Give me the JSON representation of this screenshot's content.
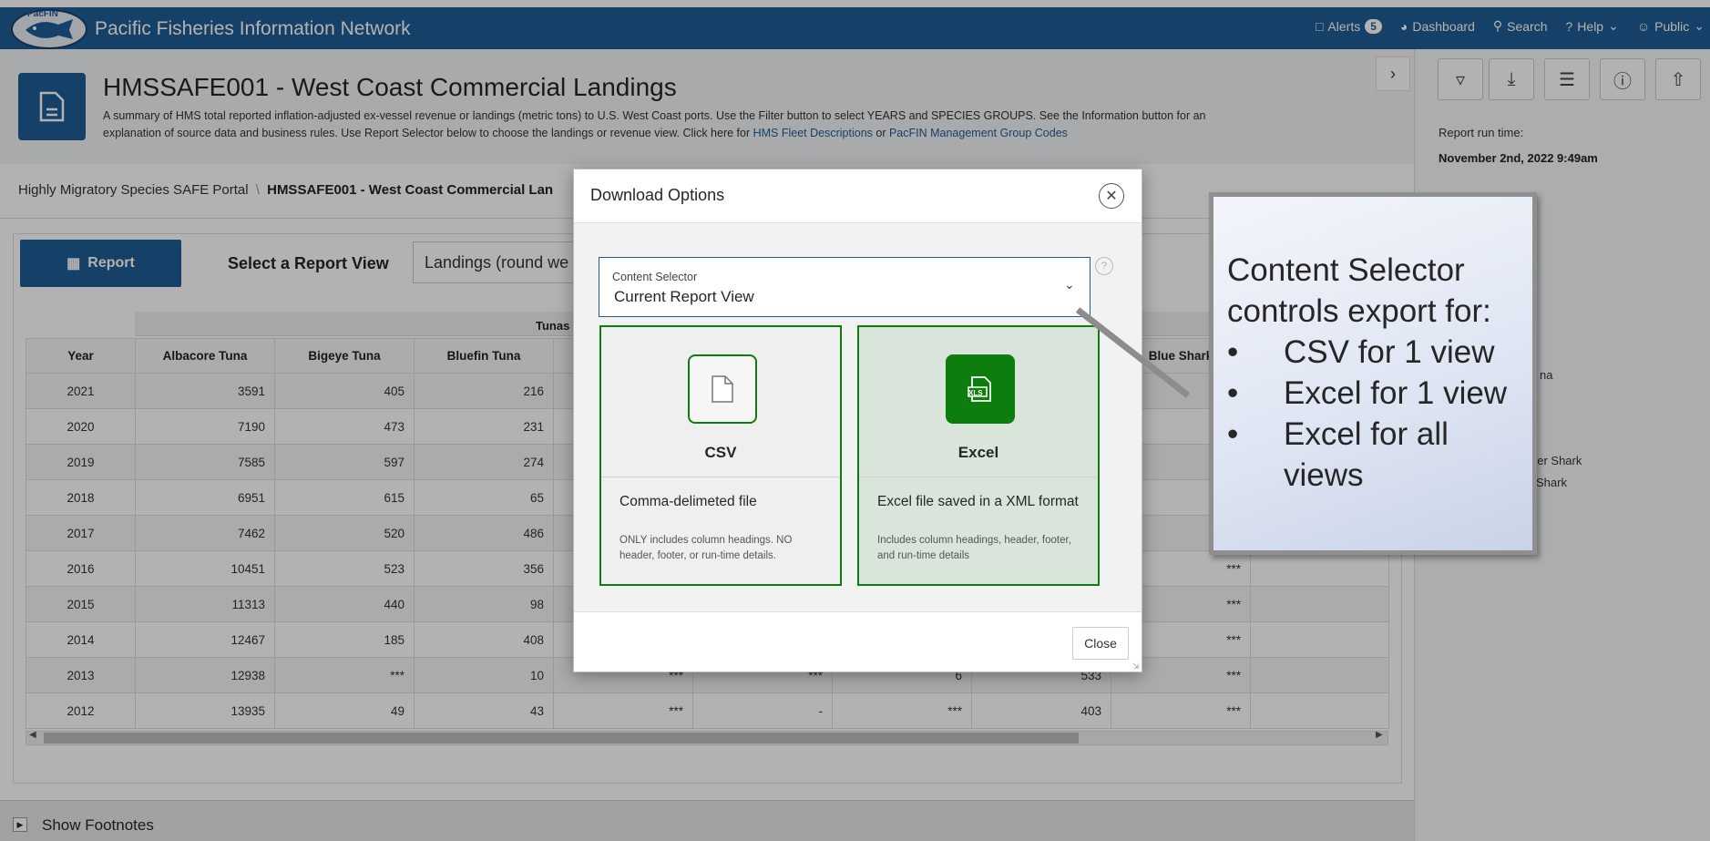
{
  "app": {
    "logo_text": "PacFIN",
    "title": "Pacific Fisheries Information Network"
  },
  "topnav": {
    "alerts_label": "Alerts",
    "alerts_count": "5",
    "dashboard_label": "Dashboard",
    "search_label": "Search",
    "help_label": "Help",
    "public_label": "Public"
  },
  "page": {
    "title": "HMSSAFE001 - West Coast Commercial Landings",
    "description_1": "A summary of HMS total reported inflation-adjusted ex-vessel revenue or landings (metric tons) to U.S. West Coast ports. Use the Filter button to select YEARS and SPECIES GROUPS. See the Information button for an",
    "description_2": "explanation of source data and business rules. Use Report Selector below to choose the landings or revenue view. Click here for ",
    "link_fleet": "HMS Fleet Descriptions",
    "link_or": " or ",
    "link_groups": "PacFIN Management Group Codes"
  },
  "breadcrumb": {
    "portal": "Highly Migratory Species SAFE Portal",
    "separator": "\\",
    "current": "HMSSAFE001 - West Coast Commercial Lan"
  },
  "side": {
    "run_label": "Report run time:",
    "run_value": "November 2nd, 2022 9:49am",
    "item_1": "na",
    "item_2": "her Shark",
    "item_3": "Shark"
  },
  "report": {
    "button_label": "Report",
    "view_label": "Select a Report View",
    "view_value": "Landings (round we",
    "group_header": "Tunas",
    "columns": [
      "Year",
      "Albacore Tuna",
      "Bigeye Tuna",
      "Bluefin Tuna",
      "",
      "",
      "",
      "",
      "Blue Shark",
      ""
    ],
    "rows": [
      [
        "2021",
        "3591",
        "405",
        "216",
        "",
        "",
        "",
        "",
        "",
        ""
      ],
      [
        "2020",
        "7190",
        "473",
        "231",
        "",
        "",
        "",
        "",
        "",
        ""
      ],
      [
        "2019",
        "7585",
        "597",
        "274",
        "",
        "",
        "",
        "",
        "",
        ""
      ],
      [
        "2018",
        "6951",
        "615",
        "65",
        "",
        "",
        "",
        "",
        "",
        ""
      ],
      [
        "2017",
        "7462",
        "520",
        "486",
        "",
        "",
        "",
        "",
        "",
        ""
      ],
      [
        "2016",
        "10451",
        "523",
        "356",
        "",
        "",
        "",
        "",
        "***",
        ""
      ],
      [
        "2015",
        "11313",
        "440",
        "98",
        "",
        "",
        "",
        "",
        "***",
        ""
      ],
      [
        "2014",
        "12467",
        "185",
        "408",
        "",
        "",
        "",
        "",
        "***",
        ""
      ],
      [
        "2013",
        "12938",
        "***",
        "10",
        "***",
        "***",
        "6",
        "533",
        "***",
        ""
      ],
      [
        "2012",
        "13935",
        "49",
        "43",
        "***",
        "-",
        "***",
        "403",
        "***",
        ""
      ]
    ]
  },
  "footnotes": {
    "label": "Show Footnotes"
  },
  "modal": {
    "title": "Download Options",
    "content_selector_label": "Content Selector",
    "content_selector_value": "Current Report View",
    "help": "?",
    "csv": {
      "icon_text": "",
      "title": "CSV",
      "description": "Comma-delimeted file",
      "note": "ONLY includes column headings. NO header, footer, or run-time details."
    },
    "excel": {
      "icon_text": "XLS",
      "title": "Excel",
      "description": "Excel file saved in a XML format",
      "note": "Includes column headings, header, footer, and run-time details"
    },
    "close_label": "Close"
  },
  "callout": {
    "title": "Content Selector controls export for:",
    "items": [
      "CSV for 1 view",
      "Excel for 1 view",
      "Excel for all views"
    ]
  },
  "colors": {
    "brand_blue": "#1f5c94",
    "excel_green": "#0d7d0d"
  }
}
